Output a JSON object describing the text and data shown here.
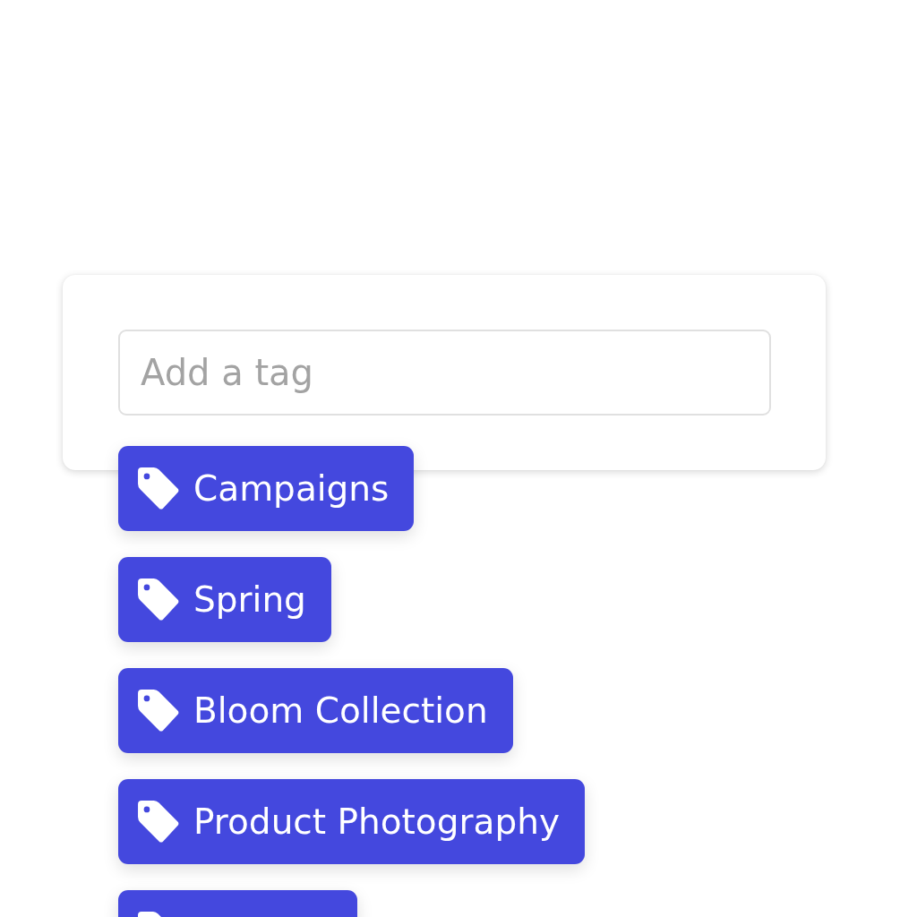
{
  "input": {
    "placeholder": "Add a tag"
  },
  "tags": [
    {
      "kind": "tag",
      "label": "Campaigns"
    },
    {
      "kind": "tag",
      "label": "Spring"
    },
    {
      "kind": "tag",
      "label": "Bloom Collection"
    },
    {
      "kind": "tag",
      "label": "Product Photography"
    },
    {
      "kind": "cut"
    }
  ]
}
